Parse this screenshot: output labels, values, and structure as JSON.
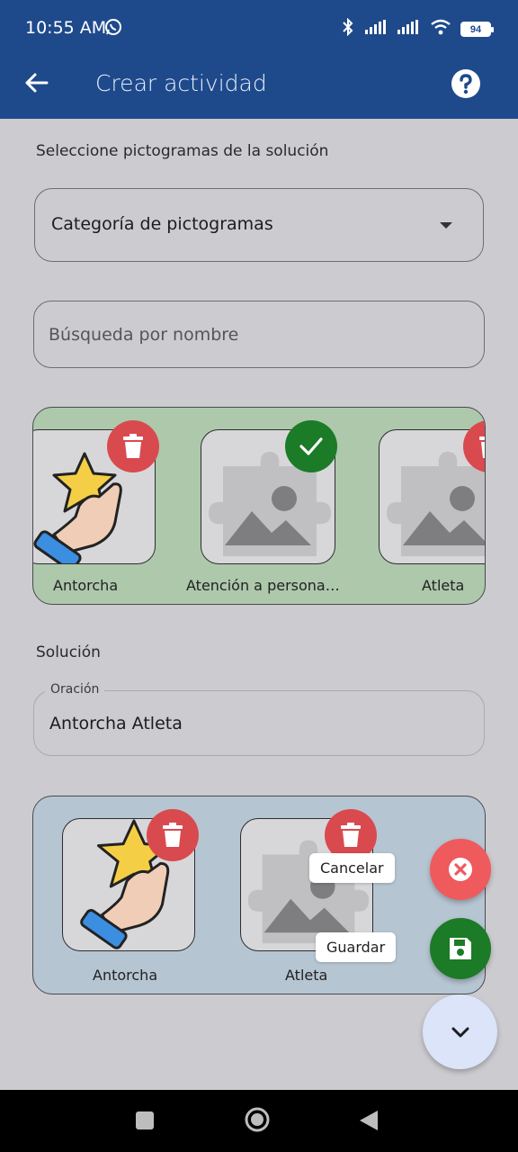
{
  "status": {
    "time": "10:55 AM",
    "battery": "94"
  },
  "appbar": {
    "title": "Crear actividad"
  },
  "select_label": "Seleccione pictogramas de la solución",
  "category": {
    "value": "Categoría de pictogramas"
  },
  "search": {
    "placeholder": "Búsqueda por nombre"
  },
  "pictograms": [
    {
      "label": "Antorcha",
      "image": "star-hand",
      "badge": "delete"
    },
    {
      "label": "Atención a persona…",
      "image": "placeholder",
      "badge": "check"
    },
    {
      "label": "Atleta",
      "image": "placeholder",
      "badge": "delete"
    }
  ],
  "solution": {
    "label": "Solución",
    "oracion_label": "Oración",
    "oracion_value": "Antorcha Atleta",
    "items": [
      {
        "label": "Antorcha",
        "image": "star-hand"
      },
      {
        "label": "Atleta",
        "image": "placeholder"
      }
    ]
  },
  "actions": {
    "cancel": "Cancelar",
    "save": "Guardar"
  },
  "colors": {
    "primary": "#1e4a8c",
    "delete": "#d94a4e",
    "check": "#1b7b26",
    "cancel_fab": "#ef5a5d",
    "save_fab": "#1b7b26"
  }
}
